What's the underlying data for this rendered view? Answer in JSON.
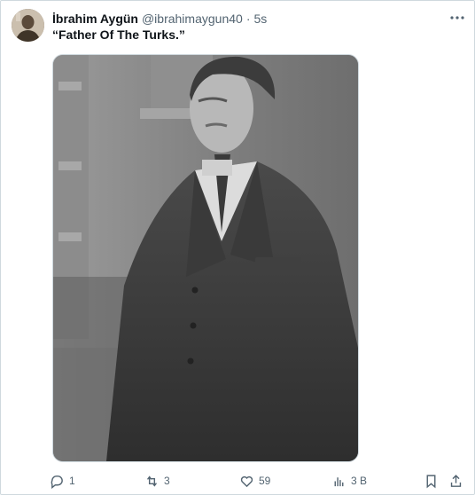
{
  "tweet": {
    "author_name": "İbrahim Aygün",
    "handle": "@ibrahimaygun40",
    "separator": "·",
    "time": "5s",
    "text": "“Father Of The Turks.”",
    "media_icon": "portrait-photo"
  },
  "actions": {
    "reply_count": "1",
    "repost_count": "3",
    "like_count": "59",
    "views_count": "3 B"
  },
  "icons": {
    "more": "more-icon",
    "reply": "reply-icon",
    "repost": "repost-icon",
    "like": "heart-icon",
    "views": "views-icon",
    "bookmark": "bookmark-icon",
    "share": "share-icon"
  },
  "colors": {
    "text_primary": "#0f1419",
    "text_secondary": "#536471",
    "border": "#cfd9de"
  }
}
